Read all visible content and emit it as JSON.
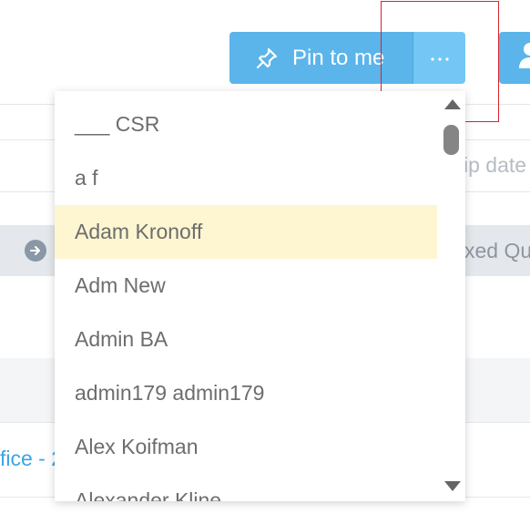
{
  "toolbar": {
    "pin_label": "Pin to me",
    "more_icon": "ellipsis-icon",
    "user_icon": "user-icon"
  },
  "background": {
    "ship_date_header": "ip date",
    "linked_text": "xed Qu",
    "link_text": "fice - 2"
  },
  "dropdown": {
    "items": [
      "___ CSR",
      "a f",
      "Adam Kronoff",
      "Adm New",
      "Admin BA",
      "admin179 admin179",
      "Alex Koifman",
      "Alexander Kline"
    ],
    "highlighted": "Adam Kronoff"
  },
  "colors": {
    "primary": "#5bb4ea",
    "primary_light": "#74c7f4",
    "highlight": "#fdf6d1",
    "annotation_red": "#d9242b"
  }
}
